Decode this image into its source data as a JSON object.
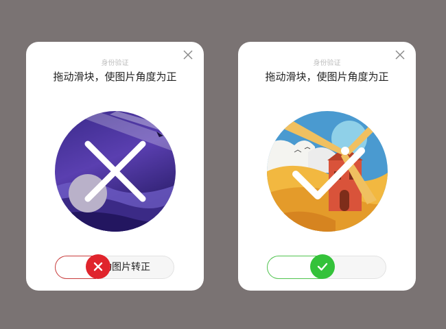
{
  "colors": {
    "background": "#7a7373",
    "card": "#ffffff",
    "error": "#e0242c",
    "success": "#34c23a"
  },
  "cards": [
    {
      "state": "fail",
      "subtitle": "身份验证",
      "title": "拖动滑块，使图片角度为正",
      "overlay_icon": "cross-icon",
      "slider_label": "滑动图片转正",
      "slider_progress": 0.3
    },
    {
      "state": "success",
      "subtitle": "身份验证",
      "title": "拖动滑块，使图片角度为正",
      "overlay_icon": "check-icon",
      "slider_label": "",
      "slider_progress": 0.4
    }
  ]
}
